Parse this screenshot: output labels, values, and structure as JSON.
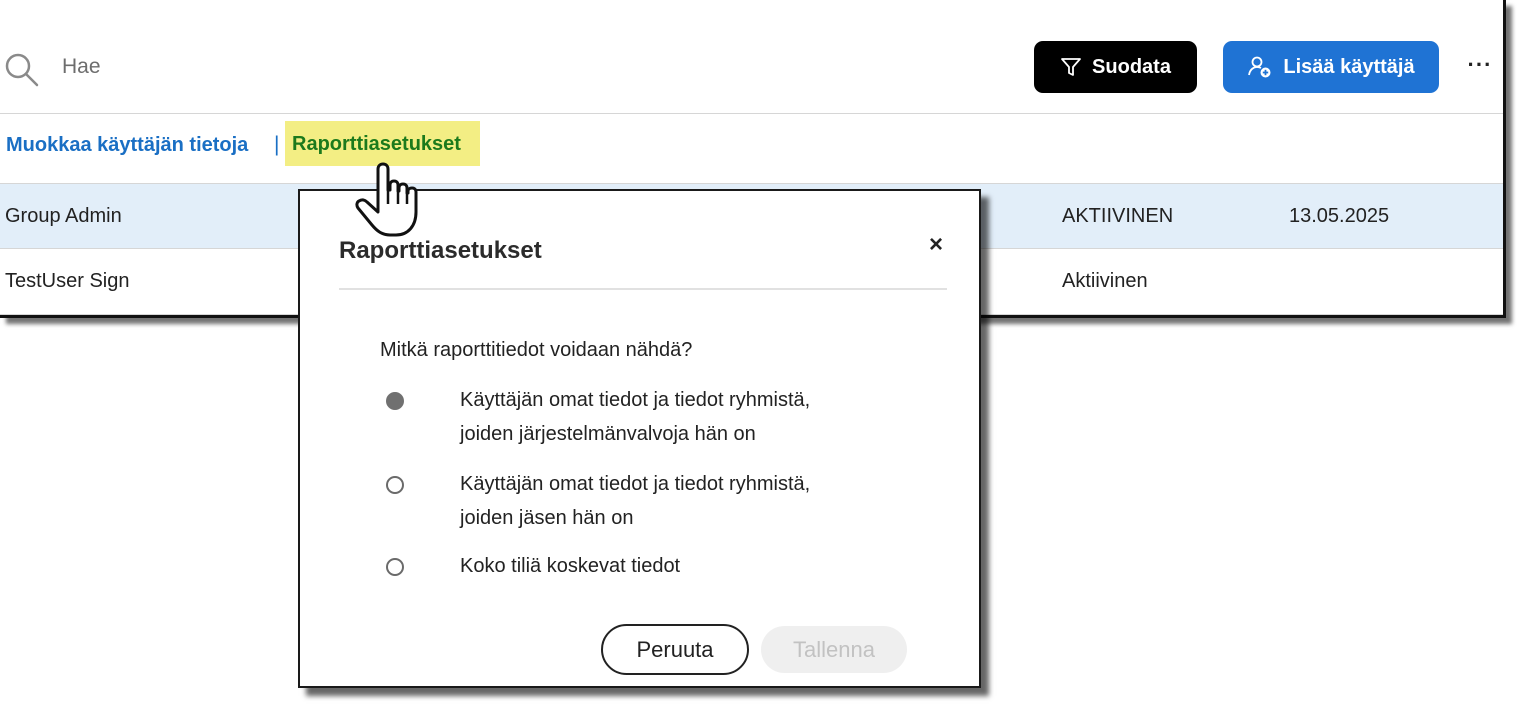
{
  "search": {
    "placeholder": "Hae",
    "icon": "search-icon"
  },
  "toolbar": {
    "filter_label": "Suodata",
    "add_user_label": "Lisää käyttäjä",
    "more_label": "···"
  },
  "actions": {
    "edit_link": "Muokkaa käyttäjän tietoja",
    "separator": "|",
    "report_link": "Raporttiasetukset"
  },
  "table": {
    "rows": [
      {
        "name": "Group Admin",
        "status": "AKTIIVINEN",
        "date": "13.05.2025",
        "selected": true
      },
      {
        "name": "TestUser Sign",
        "status": "Aktiivinen",
        "date": ""
      }
    ]
  },
  "dialog": {
    "title": "Raporttiasetukset",
    "close": "×",
    "question": "Mitkä raporttitiedot voidaan nähdä?",
    "options": [
      {
        "line1": "Käyttäjän omat tiedot ja tiedot ryhmistä,",
        "line2": "joiden järjestelmänvalvoja hän on",
        "checked": true
      },
      {
        "line1": "Käyttäjän omat tiedot ja tiedot ryhmistä,",
        "line2": "joiden jäsen hän on",
        "checked": false
      },
      {
        "line1": "Koko tiliä koskevat tiedot",
        "line2": "",
        "checked": false
      }
    ],
    "cancel_label": "Peruuta",
    "save_label": "Tallenna"
  },
  "colors": {
    "accent_blue": "#1f73d4",
    "link_blue": "#1a6fc4",
    "highlight_yellow": "#f3ee84",
    "selected_row": "#e2eef9"
  }
}
